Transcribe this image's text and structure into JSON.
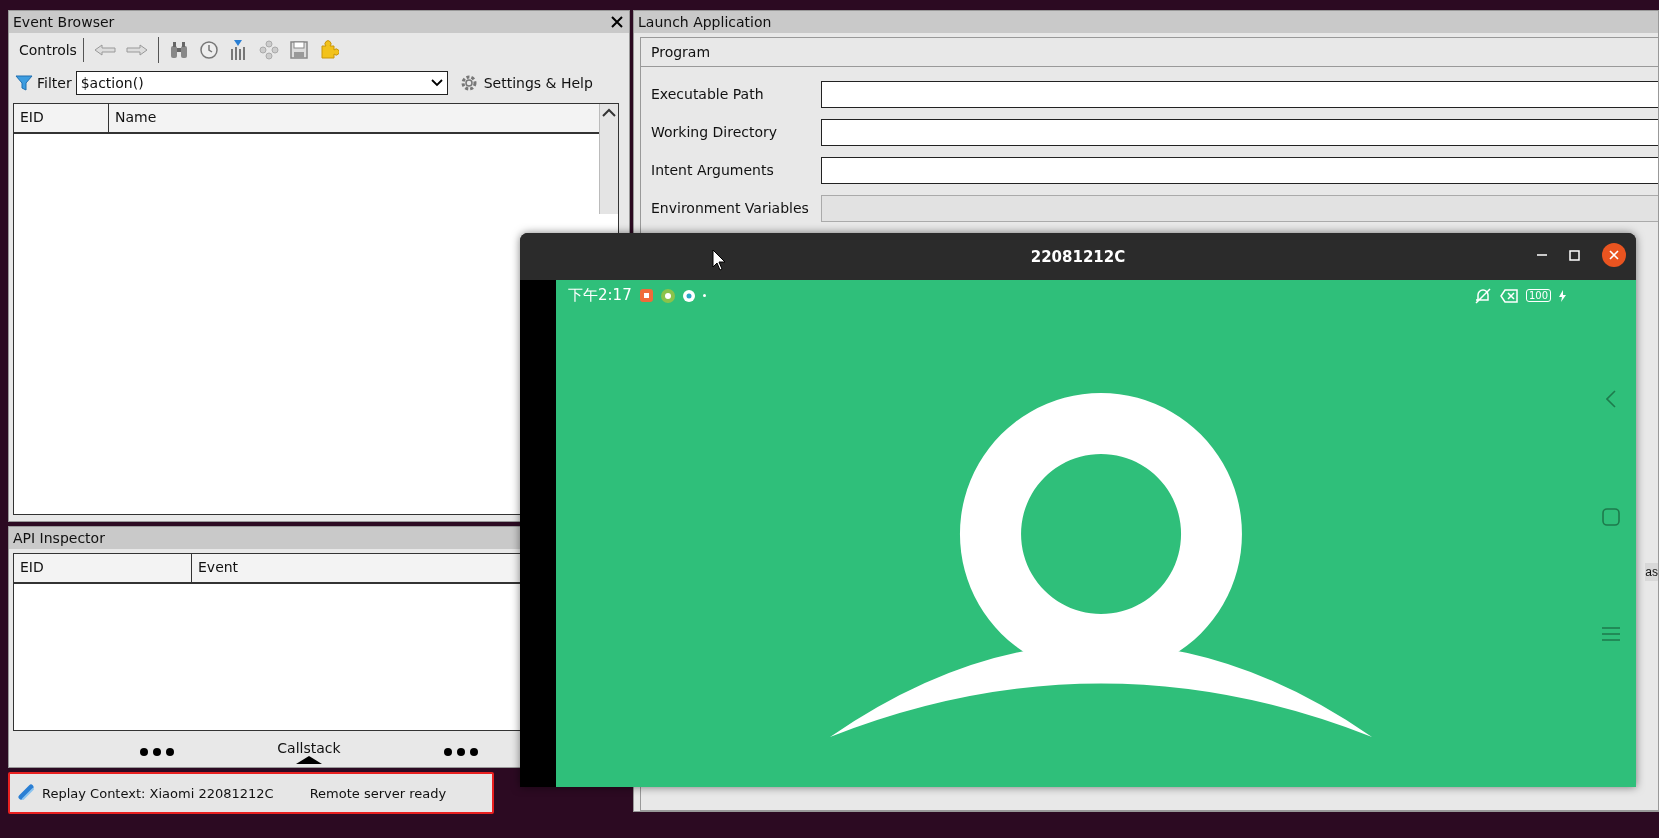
{
  "event_browser": {
    "title": "Event Browser",
    "tab": "Controls",
    "filter_label": "Filter",
    "filter_value": "$action()",
    "settings_link": "Settings & Help",
    "columns": [
      "EID",
      "Name"
    ]
  },
  "api_inspector": {
    "title": "API Inspector",
    "columns": [
      "EID",
      "Event"
    ],
    "callstack_label": "Callstack"
  },
  "status_bar": {
    "replay_context": "Replay Context: Xiaomi 22081212C",
    "server_status": "Remote server ready"
  },
  "launch_application": {
    "title": "Launch Application",
    "section": "Program",
    "fields": [
      {
        "label": "Executable Path",
        "disabled": false
      },
      {
        "label": "Working Directory",
        "disabled": false
      },
      {
        "label": "Intent Arguments",
        "disabled": false
      },
      {
        "label": "Environment Variables",
        "disabled": true
      }
    ],
    "cut_label": "as"
  },
  "device_window": {
    "title": "22081212C",
    "phone_status": {
      "time": "下午2:17",
      "battery": "100"
    }
  }
}
